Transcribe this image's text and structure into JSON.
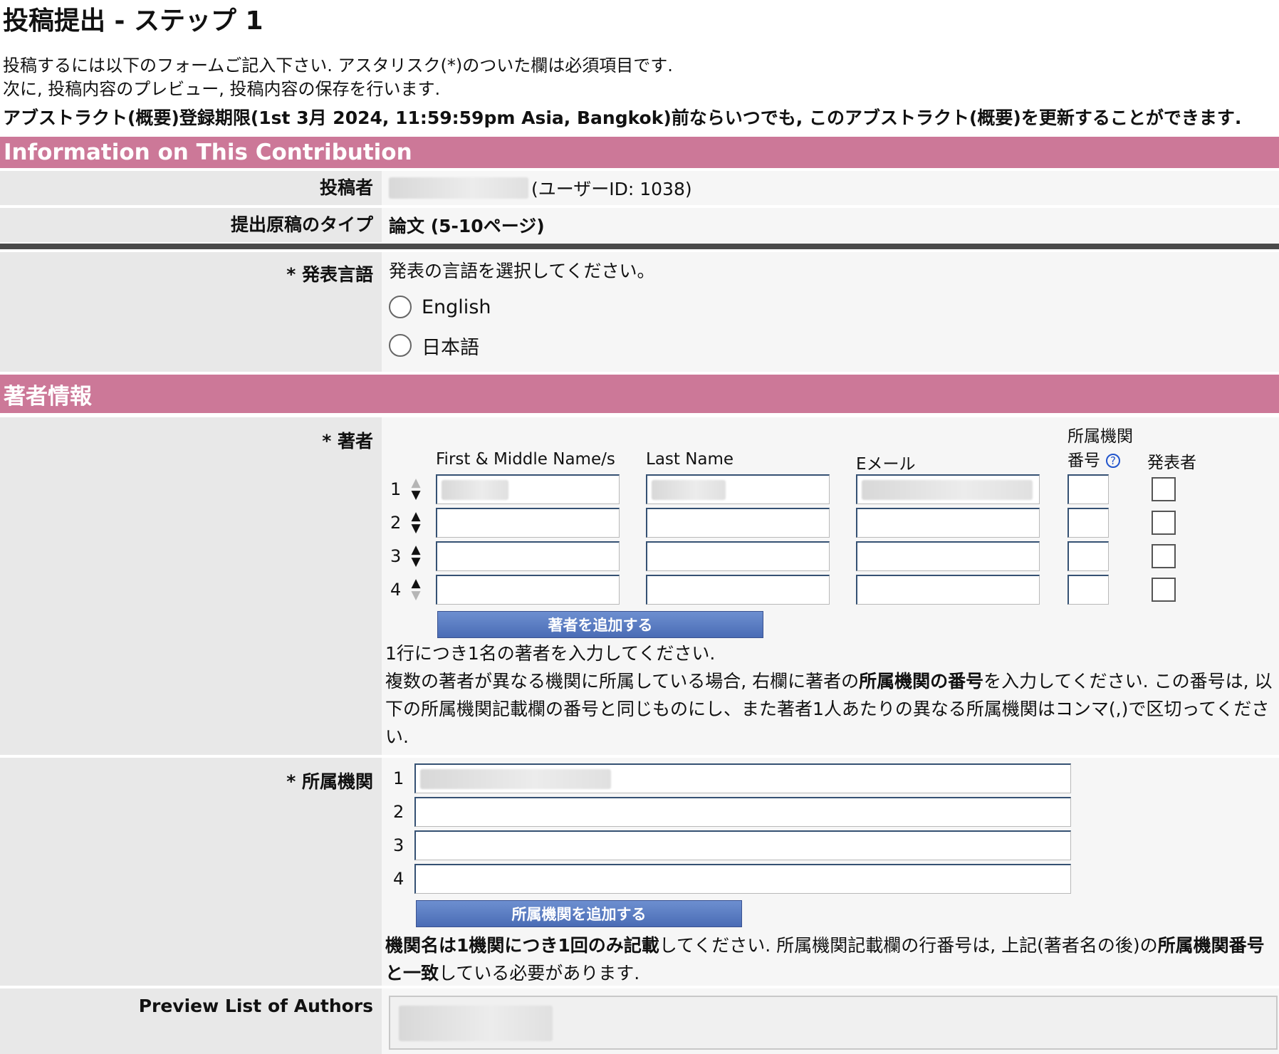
{
  "page": {
    "title": "投稿提出 - ステップ 1",
    "intro_line1": "投稿するには以下のフォームご記入下さい. アスタリスク(*)のついた欄は必須項目です.",
    "intro_line2": "次に, 投稿内容のプレビュー, 投稿内容の保存を行います.",
    "deadline": "アブストラクト(概要)登録期限(1st 3月 2024, 11:59:59pm Asia, Bangkok)前ならいつでも, このアブストラクト(概要)を更新することができます."
  },
  "contribution": {
    "header": "Information on This Contribution",
    "submitter_label": "投稿者",
    "submitter_id": "(ユーザーID: 1038)",
    "type_label": "提出原稿のタイプ",
    "type_value": "論文 (5-10ページ)",
    "language_label": "* 発表言語",
    "language_prompt": "発表の言語を選択してください。",
    "language_options": [
      "English",
      "日本語"
    ]
  },
  "authors": {
    "header": "著者情報",
    "label": "* 著者",
    "col_first": "First & Middle Name/s",
    "col_last": "Last Name",
    "col_email": "Eメール",
    "col_affil_1": "所属機関",
    "col_affil_2": "番号",
    "col_presenter": "発表者",
    "row_numbers": [
      "1",
      "2",
      "3",
      "4"
    ],
    "add_button": "著者を追加する",
    "help_line1": "1行につき1名の著者を入力してください.",
    "help_p2_a": "複数の著者が異なる機関に所属している場合, 右欄に著者の",
    "help_p2_bold": "所属機関の番号",
    "help_p2_b": "を入力してください. この番号は, 以下の所属機関記載欄の番号と同じものにし、また著者1人あたりの異なる所属機関はコンマ(,)で区切ってください."
  },
  "affiliations": {
    "label": "* 所属機関",
    "row_numbers": [
      "1",
      "2",
      "3",
      "4"
    ],
    "add_button": "所属機関を追加する",
    "help_bold1": "機関名は1機関につき1回のみ記載",
    "help_mid": "してください. 所属機関記載欄の行番号は, 上記(著者名の後)の",
    "help_bold2": "所属機関番号と一致",
    "help_end": "している必要があります."
  },
  "preview": {
    "label": "Preview List of Authors"
  },
  "colors": {
    "section_bar": "#cc7898",
    "label_bg": "#e8e8e8",
    "value_bg": "#f6f6f6",
    "button": "#4a6cb5"
  }
}
